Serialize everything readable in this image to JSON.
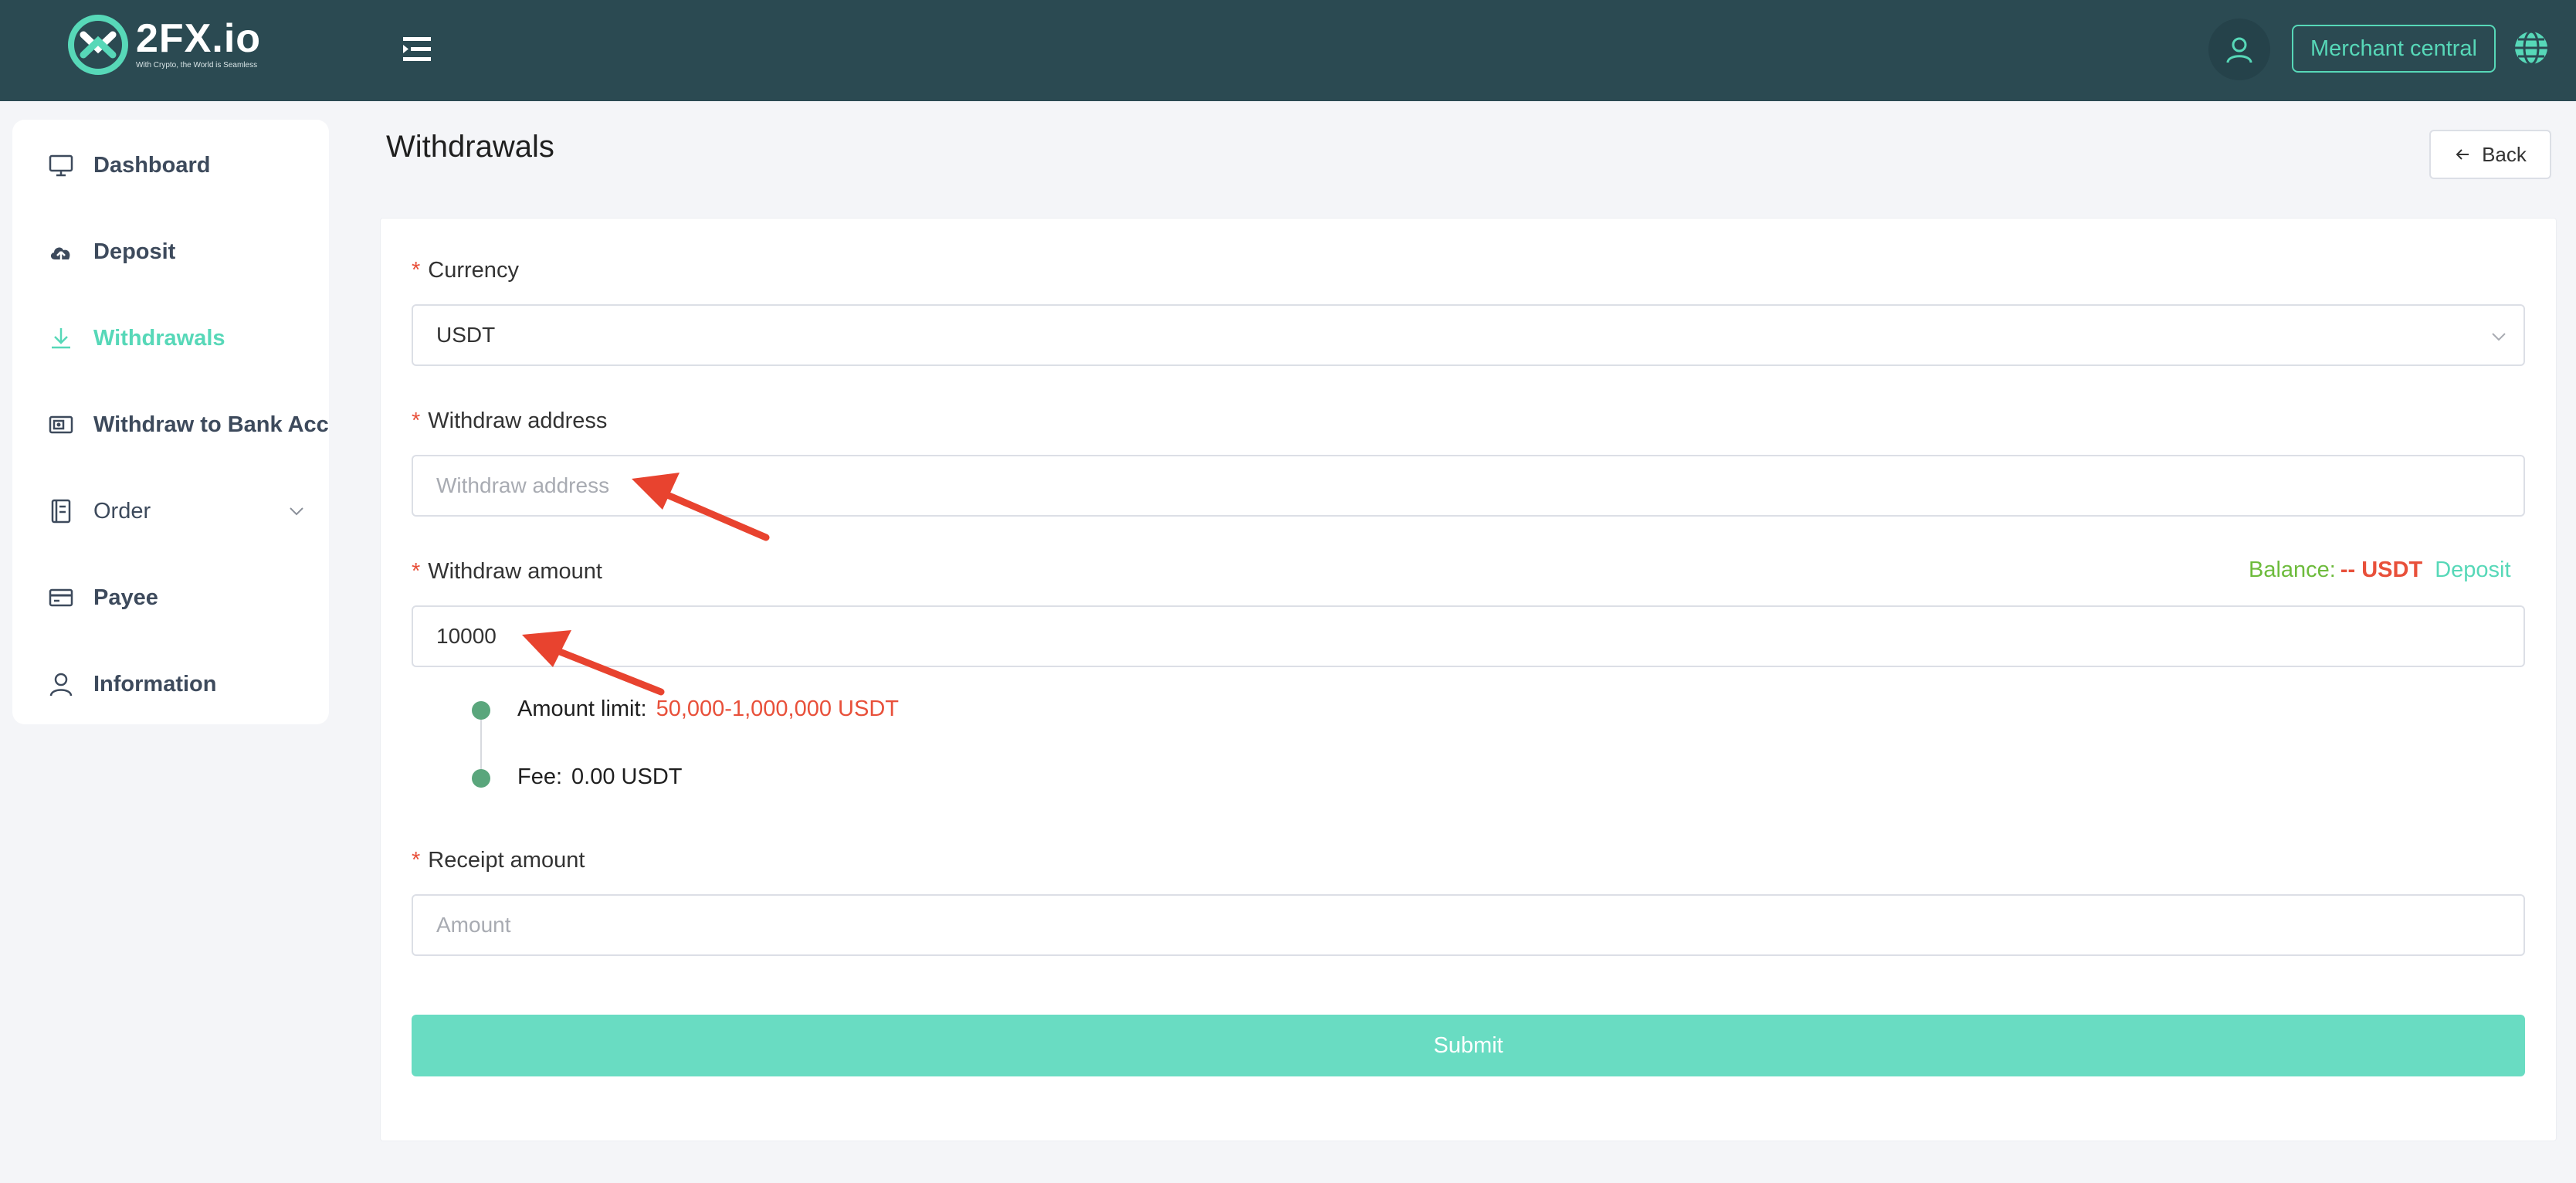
{
  "header": {
    "logo_name": "2FX.io",
    "logo_tagline": "With Crypto, the World is Seamless",
    "merchant_label": "Merchant central"
  },
  "sidebar": {
    "items": [
      {
        "label": "Dashboard",
        "icon": "monitor-icon"
      },
      {
        "label": "Deposit",
        "icon": "cloud-upload-icon"
      },
      {
        "label": "Withdrawals",
        "icon": "download-icon",
        "active": true
      },
      {
        "label": "Withdraw to Bank Account",
        "icon": "bank-card-icon"
      },
      {
        "label": "Order",
        "icon": "document-icon"
      },
      {
        "label": "Payee",
        "icon": "credit-card-icon"
      },
      {
        "label": "Information",
        "icon": "user-icon"
      }
    ]
  },
  "page": {
    "title": "Withdrawals",
    "back_label": "Back"
  },
  "form": {
    "currency_label": "Currency",
    "currency_value": "USDT",
    "address_label": "Withdraw address",
    "address_placeholder": "Withdraw address",
    "amount_label": "Withdraw amount",
    "amount_value": "10000",
    "balance_label": "Balance:",
    "balance_value": "-- USDT",
    "deposit_link": "Deposit",
    "amount_limit_label": "Amount limit:",
    "amount_limit_value": "50,000-1,000,000 USDT",
    "fee_label": "Fee:",
    "fee_value": "0.00 USDT",
    "receipt_label": "Receipt amount",
    "receipt_placeholder": "Amount",
    "submit_label": "Submit",
    "required_mark": "*"
  },
  "colors": {
    "header_bg": "#2b4a52",
    "accent": "#57d8b8",
    "required": "#e8503a",
    "balance_label": "#6dbb3c",
    "submit_bg": "#69dcc2",
    "annotation_arrow": "#e8432f"
  }
}
